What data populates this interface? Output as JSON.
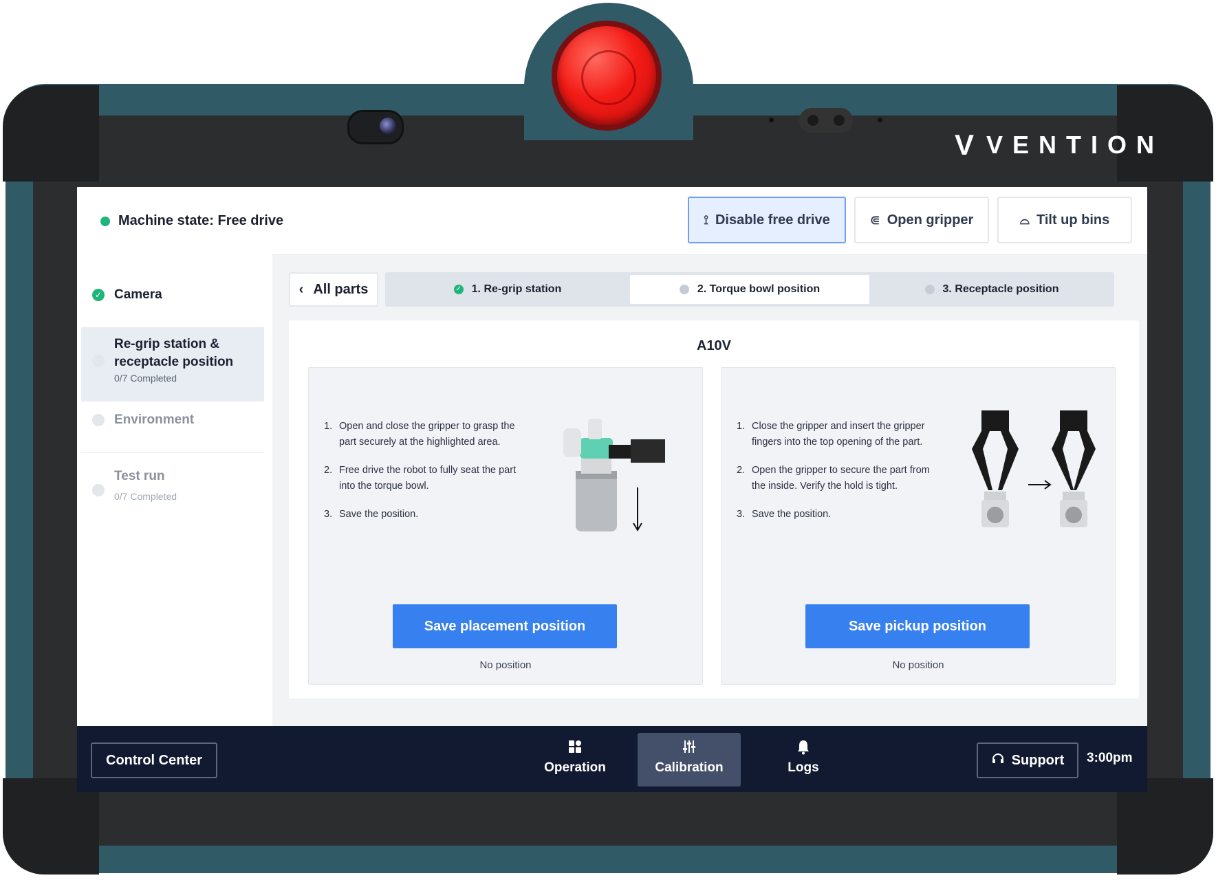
{
  "brand": {
    "mark": "V",
    "name": "VENTION"
  },
  "machine_state": {
    "label": "Machine state: Free drive",
    "status_color": "#1fb57a"
  },
  "toolbar": {
    "disable_free_drive": "Disable free drive",
    "open_gripper": "Open gripper",
    "tilt_up_bins": "Tilt up bins"
  },
  "sidebar": {
    "items": [
      {
        "label": "Camera",
        "status": "done"
      },
      {
        "label_line1": "Re-grip station &",
        "label_line2": "receptacle position",
        "progress": "0/7 Completed",
        "status": "active"
      },
      {
        "label": "Environment",
        "status": "todo"
      },
      {
        "label": "Test run",
        "progress": "0/7 Completed",
        "status": "todo"
      }
    ]
  },
  "nav": {
    "back_label": "All parts"
  },
  "steps": [
    {
      "label": "1. Re-grip station",
      "status": "done"
    },
    {
      "label": "2. Torque bowl position",
      "status": "active"
    },
    {
      "label": "3. Receptacle position",
      "status": "todo"
    }
  ],
  "part": {
    "name": "A10V"
  },
  "panels": {
    "placement": {
      "instructions": [
        "Open and close the gripper to grasp the part securely at the highlighted area.",
        "Free drive the robot to fully seat the part into the torque bowl.",
        "Save the position."
      ],
      "button": "Save placement position",
      "status": "No position",
      "illustration": "part-in-gripper-illustration"
    },
    "pickup": {
      "instructions": [
        "Close the gripper and insert the gripper fingers into the top opening of the part.",
        "Open the gripper to secure the part from the inside. Verify the hold is tight.",
        "Save the position."
      ],
      "button": "Save pickup position",
      "status": "No position",
      "illustration": "gripper-open-close-illustration"
    }
  },
  "bottom_bar": {
    "control_center": "Control Center",
    "nav": [
      {
        "label": "Operation",
        "icon": "grid-icon"
      },
      {
        "label": "Calibration",
        "icon": "sliders-icon",
        "active": true
      },
      {
        "label": "Logs",
        "icon": "bell-icon"
      }
    ],
    "support": "Support",
    "time": "3:00pm"
  },
  "colors": {
    "accent": "#3680ef",
    "success": "#1fb57a",
    "bottom_bar": "#111a30",
    "device": "#2f5a66"
  }
}
